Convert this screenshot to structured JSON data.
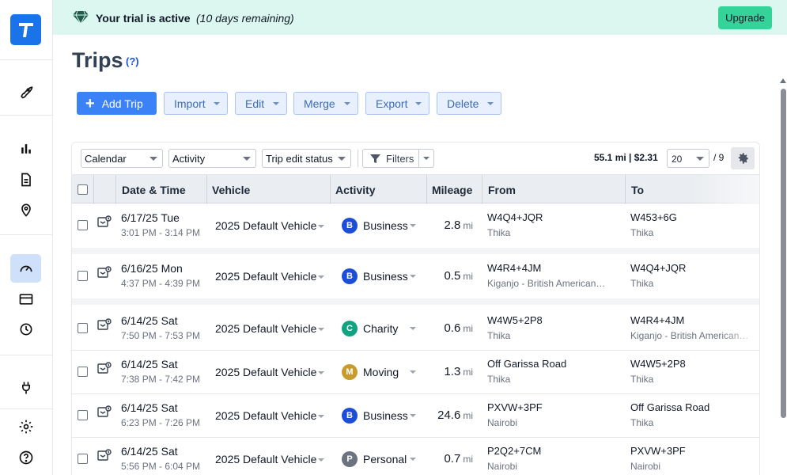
{
  "banner": {
    "title": "Your trial is active",
    "subtitle": "(10 days remaining)",
    "upgrade_label": "Upgrade",
    "accent": "#34d399",
    "icon": "gem-icon"
  },
  "sidebar": {
    "logo": "app-logo",
    "items": [
      {
        "icon": "rocket-icon"
      },
      {
        "icon": "bar-chart-icon"
      },
      {
        "icon": "document-icon"
      },
      {
        "icon": "location-pin-icon"
      },
      {
        "icon": "speedometer-icon",
        "active": true
      },
      {
        "icon": "credit-card-icon"
      },
      {
        "icon": "clock-icon"
      },
      {
        "icon": "plug-icon"
      },
      {
        "icon": "gear-icon"
      },
      {
        "icon": "help-icon"
      }
    ]
  },
  "page": {
    "title": "Trips",
    "help": "(?)"
  },
  "toolbar": {
    "add_trip": "Add Trip",
    "import": "Import",
    "edit": "Edit",
    "merge": "Merge",
    "export": "Export",
    "delete": "Delete"
  },
  "filters": {
    "calendar": "Calendar",
    "activity": "Activity",
    "trip_edit_status": "Trip edit status",
    "filters_label": "Filters",
    "summary": "55.1 mi | $2.31",
    "page_size": "20",
    "page_total": "/ 9"
  },
  "table": {
    "headers": {
      "date_time": "Date & Time",
      "vehicle": "Vehicle",
      "activity": "Activity",
      "mileage": "Mileage",
      "from": "From",
      "to": "To"
    },
    "unit": "mi",
    "rows": [
      {
        "date": "6/17/25 Tue",
        "time": "3:01 PM - 3:14 PM",
        "vehicle": "2025 Default Vehicle",
        "badge": "B",
        "badge_color": "#1d4ed8",
        "activity": "Business",
        "mileage": "2.8",
        "from1": "W4Q4+JQR",
        "from2": "Thika",
        "to1": "W453+6G",
        "to2": "Thika"
      },
      {
        "date": "6/16/25 Mon",
        "time": "4:37 PM - 4:39 PM",
        "vehicle": "2025 Default Vehicle",
        "badge": "B",
        "badge_color": "#1d4ed8",
        "activity": "Business",
        "mileage": "0.5",
        "from1": "W4R4+4JM",
        "from2": "Kiganjo - British American…",
        "to1": "W4Q4+JQR",
        "to2": "Thika"
      },
      {
        "date": "6/14/25 Sat",
        "time": "7:50 PM - 7:53 PM",
        "vehicle": "2025 Default Vehicle",
        "badge": "C",
        "badge_color": "#10a37f",
        "activity": "Charity",
        "mileage": "0.6",
        "from1": "W4W5+2P8",
        "from2": "Thika",
        "to1": "W4R4+4JM",
        "to2": "Kiganjo - British American…"
      },
      {
        "date": "6/14/25 Sat",
        "time": "7:38 PM - 7:42 PM",
        "vehicle": "2025 Default Vehicle",
        "badge": "M",
        "badge_color": "#c99a2e",
        "activity": "Moving",
        "mileage": "1.3",
        "from1": "Off Garissa Road",
        "from2": "Thika",
        "to1": "W4W5+2P8",
        "to2": "Thika"
      },
      {
        "date": "6/14/25 Sat",
        "time": "6:23 PM - 7:26 PM",
        "vehicle": "2025 Default Vehicle",
        "badge": "B",
        "badge_color": "#1d4ed8",
        "activity": "Business",
        "mileage": "24.6",
        "from1": "PXVW+3PF",
        "from2": "Nairobi",
        "to1": "Off Garissa Road",
        "to2": "Thika"
      },
      {
        "date": "6/14/25 Sat",
        "time": "5:56 PM - 6:04 PM",
        "vehicle": "2025 Default Vehicle",
        "badge": "P",
        "badge_color": "#6b7280",
        "activity": "Personal",
        "mileage": "0.7",
        "from1": "P2Q2+7CM",
        "from2": "Nairobi",
        "to1": "PXVW+3PF",
        "to2": "Nairobi"
      }
    ]
  }
}
